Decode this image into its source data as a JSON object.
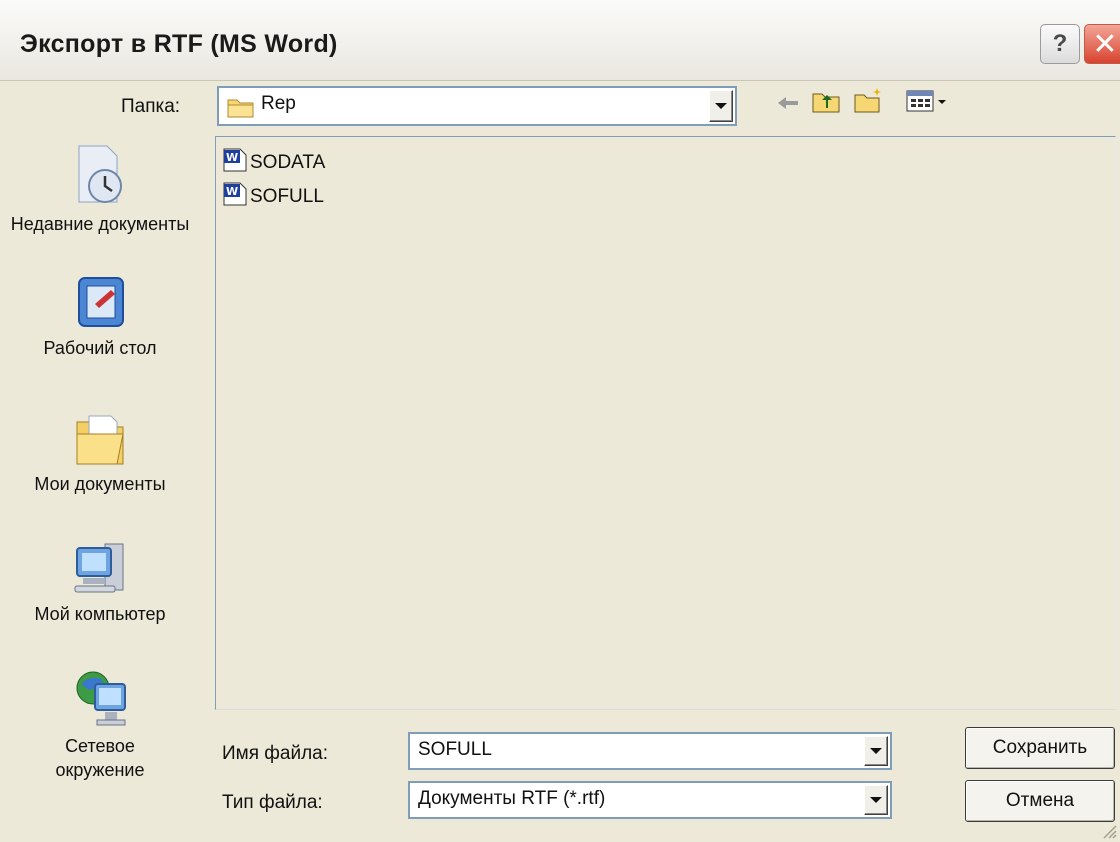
{
  "window": {
    "title": "Экспорт в RTF (MS Word)",
    "help_label": "?",
    "close_label": "✕"
  },
  "toolbar": {
    "folder_label": "Папка:",
    "folder_value": "Rep",
    "back_icon": "back-arrow-icon",
    "up_icon": "up-one-level-icon",
    "new_folder_icon": "new-folder-icon",
    "view_menu_icon": "view-menu-icon"
  },
  "places": [
    {
      "label": "Недавние документы",
      "icon": "recent-documents-icon"
    },
    {
      "label": "Рабочий стол",
      "icon": "desktop-icon"
    },
    {
      "label": "Мои документы",
      "icon": "my-documents-icon"
    },
    {
      "label": "Мой компьютер",
      "icon": "my-computer-icon"
    },
    {
      "label": "Сетевое окружение",
      "icon": "network-places-icon"
    }
  ],
  "files": [
    {
      "name": "SODATA",
      "icon": "word-document-icon"
    },
    {
      "name": "SOFULL",
      "icon": "word-document-icon"
    }
  ],
  "filename": {
    "label": "Имя файла:",
    "value": "SOFULL"
  },
  "filetype": {
    "label": "Тип файла:",
    "value": "Документы RTF (*.rtf)"
  },
  "buttons": {
    "save": "Сохранить",
    "cancel": "Отмена"
  }
}
